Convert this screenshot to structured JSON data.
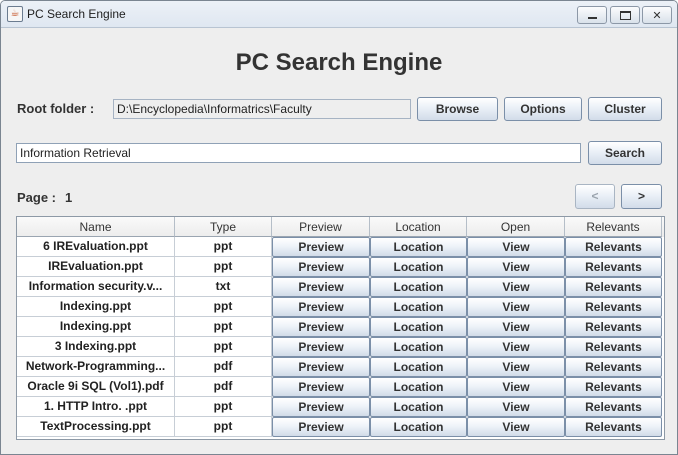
{
  "window": {
    "title": "PC Search Engine",
    "app_icon": "java-cup-icon"
  },
  "header": {
    "title": "PC Search Engine"
  },
  "root_folder": {
    "label": "Root folder :",
    "value": "D:\\Encyclopedia\\Informatrics\\Faculty",
    "browse_label": "Browse",
    "options_label": "Options",
    "cluster_label": "Cluster"
  },
  "search": {
    "value": "Information Retrieval",
    "button_label": "Search"
  },
  "paging": {
    "label": "Page :",
    "page": "1",
    "prev_label": "<",
    "next_label": ">"
  },
  "table": {
    "columns": [
      "Name",
      "Type",
      "Preview",
      "Location",
      "Open",
      "Relevants"
    ],
    "rows": [
      {
        "name": "6 IREvaluation.ppt",
        "type": "ppt",
        "preview": "Preview",
        "location": "Location",
        "open": "View",
        "relevants": "Relevants"
      },
      {
        "name": "IREvaluation.ppt",
        "type": "ppt",
        "preview": "Preview",
        "location": "Location",
        "open": "View",
        "relevants": "Relevants"
      },
      {
        "name": "Information security.v...",
        "type": "txt",
        "preview": "Preview",
        "location": "Location",
        "open": "View",
        "relevants": "Relevants"
      },
      {
        "name": "Indexing.ppt",
        "type": "ppt",
        "preview": "Preview",
        "location": "Location",
        "open": "View",
        "relevants": "Relevants"
      },
      {
        "name": "Indexing.ppt",
        "type": "ppt",
        "preview": "Preview",
        "location": "Location",
        "open": "View",
        "relevants": "Relevants"
      },
      {
        "name": "3 Indexing.ppt",
        "type": "ppt",
        "preview": "Preview",
        "location": "Location",
        "open": "View",
        "relevants": "Relevants"
      },
      {
        "name": "Network-Programming...",
        "type": "pdf",
        "preview": "Preview",
        "location": "Location",
        "open": "View",
        "relevants": "Relevants"
      },
      {
        "name": "Oracle 9i SQL (Vol1).pdf",
        "type": "pdf",
        "preview": "Preview",
        "location": "Location",
        "open": "View",
        "relevants": "Relevants"
      },
      {
        "name": "1. HTTP Intro. .ppt",
        "type": "ppt",
        "preview": "Preview",
        "location": "Location",
        "open": "View",
        "relevants": "Relevants"
      },
      {
        "name": "TextProcessing.ppt",
        "type": "ppt",
        "preview": "Preview",
        "location": "Location",
        "open": "View",
        "relevants": "Relevants"
      }
    ]
  }
}
